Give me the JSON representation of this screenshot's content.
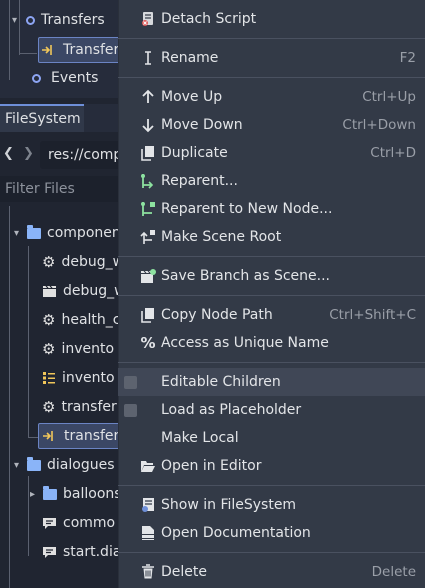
{
  "scene_tree": {
    "items": [
      {
        "label": "Transfers"
      },
      {
        "label": "Transfer"
      },
      {
        "label": "Events"
      }
    ]
  },
  "filesystem": {
    "tab_label": "FileSystem",
    "path": "res://comp",
    "filter_placeholder": "Filter Files",
    "items": [
      {
        "label": "componen"
      },
      {
        "label": "debug_w"
      },
      {
        "label": "debug_w"
      },
      {
        "label": "health_c"
      },
      {
        "label": "invento"
      },
      {
        "label": "invento"
      },
      {
        "label": "transfer"
      },
      {
        "label": "transfer"
      },
      {
        "label": "dialogues"
      },
      {
        "label": "balloons"
      },
      {
        "label": "commo"
      },
      {
        "label": "start.dia"
      }
    ]
  },
  "context_menu": {
    "items": [
      {
        "label": "Detach Script",
        "shortcut": "",
        "icon": "detach-script-icon"
      },
      {
        "label": "Rename",
        "shortcut": "F2",
        "icon": "rename-icon"
      },
      {
        "label": "Move Up",
        "shortcut": "Ctrl+Up",
        "icon": "arrow-up-icon"
      },
      {
        "label": "Move Down",
        "shortcut": "Ctrl+Down",
        "icon": "arrow-down-icon"
      },
      {
        "label": "Duplicate",
        "shortcut": "Ctrl+D",
        "icon": "duplicate-icon"
      },
      {
        "label": "Reparent...",
        "shortcut": "",
        "icon": "reparent-icon"
      },
      {
        "label": "Reparent to New Node...",
        "shortcut": "",
        "icon": "reparent-new-node-icon"
      },
      {
        "label": "Make Scene Root",
        "shortcut": "",
        "icon": "make-root-icon"
      },
      {
        "label": "Save Branch as Scene...",
        "shortcut": "",
        "icon": "save-branch-icon"
      },
      {
        "label": "Copy Node Path",
        "shortcut": "Ctrl+Shift+C",
        "icon": "copy-path-icon"
      },
      {
        "label": "Access as Unique Name",
        "shortcut": "",
        "icon": "percent-icon"
      },
      {
        "label": "Editable Children",
        "shortcut": "",
        "icon": "checkbox"
      },
      {
        "label": "Load as Placeholder",
        "shortcut": "",
        "icon": "checkbox"
      },
      {
        "label": "Make Local",
        "shortcut": "",
        "icon": ""
      },
      {
        "label": "Open in Editor",
        "shortcut": "",
        "icon": "folder-open-icon"
      },
      {
        "label": "Show in FileSystem",
        "shortcut": "",
        "icon": "show-in-filesystem-icon"
      },
      {
        "label": "Open Documentation",
        "shortcut": "",
        "icon": "documentation-icon"
      },
      {
        "label": "Delete",
        "shortcut": "Delete",
        "icon": "trash-icon"
      }
    ]
  },
  "colors": {
    "accent": "#6e8fd8",
    "menu_bg": "#333a47",
    "highlight": "#404756"
  }
}
